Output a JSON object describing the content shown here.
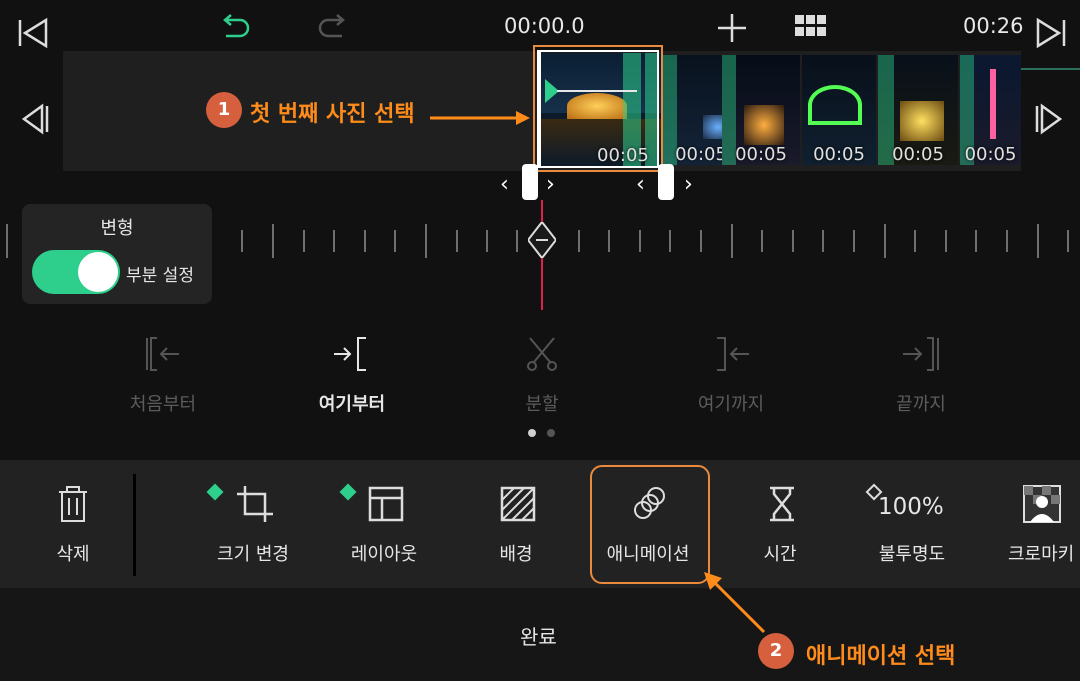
{
  "header": {
    "current_time": "00:00.0",
    "total_time": "00:26"
  },
  "timeline": {
    "clip_durations": [
      "00:05",
      "00:05",
      "00:05",
      "00:05",
      "00:05",
      "00:05"
    ]
  },
  "transform_panel": {
    "title": "변형",
    "toggle_label": "부분 설정",
    "toggle_on": true
  },
  "edit_ops": [
    {
      "label": "처음부터",
      "enabled": false
    },
    {
      "label": "여기부터",
      "enabled": true
    },
    {
      "label": "분할",
      "enabled": false
    },
    {
      "label": "여기까지",
      "enabled": false
    },
    {
      "label": "끝까지",
      "enabled": false
    }
  ],
  "toolbar": {
    "delete": "삭제",
    "resize": "크기 변경",
    "layout": "레이아웃",
    "background": "배경",
    "animation": "애니메이션",
    "time": "시간",
    "opacity": "불투명도",
    "opacity_value": "100%",
    "chroma": "크로마키"
  },
  "footer": {
    "done": "완료"
  },
  "annotations": {
    "step1_num": "1",
    "step1_text": "첫 번째 사진 선택",
    "step2_num": "2",
    "step2_text": "애니메이션 선택",
    "highlight_color": "#e98a3c"
  },
  "colors": {
    "accent": "#2ecf8c",
    "playhead": "#e0204a"
  }
}
